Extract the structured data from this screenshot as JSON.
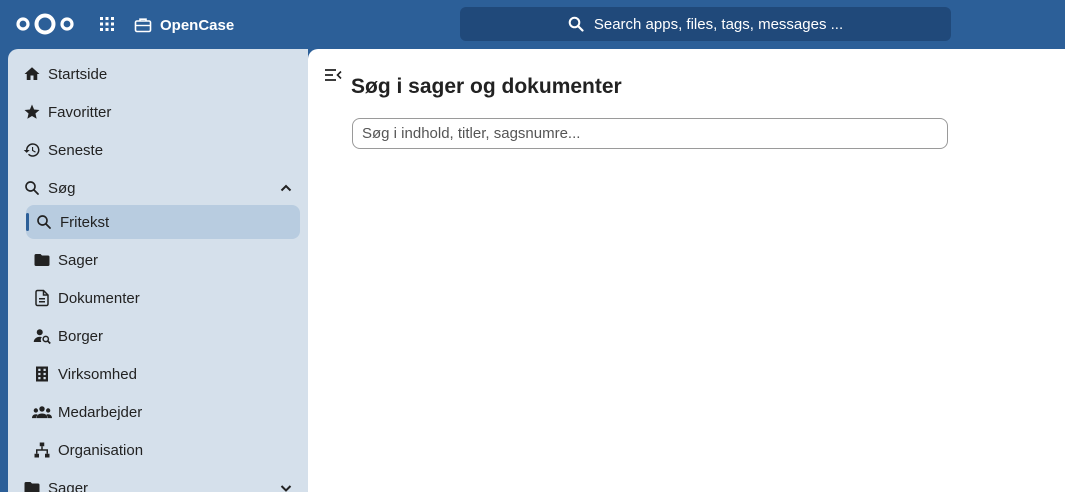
{
  "header": {
    "app_name": "OpenCase",
    "search_placeholder": "Search apps, files, tags, messages ..."
  },
  "sidebar": {
    "items": [
      {
        "label": "Startside",
        "icon": "home-icon"
      },
      {
        "label": "Favoritter",
        "icon": "star-icon"
      },
      {
        "label": "Seneste",
        "icon": "history-icon"
      },
      {
        "label": "Søg",
        "icon": "search-icon",
        "expanded": true
      },
      {
        "label": "Sager",
        "icon": "folder-icon",
        "expanded": false
      }
    ],
    "search_children": [
      {
        "label": "Fritekst",
        "icon": "search-icon",
        "active": true
      },
      {
        "label": "Sager",
        "icon": "folder-icon"
      },
      {
        "label": "Dokumenter",
        "icon": "document-icon"
      },
      {
        "label": "Borger",
        "icon": "person-search-icon"
      },
      {
        "label": "Virksomhed",
        "icon": "building-icon"
      },
      {
        "label": "Medarbejder",
        "icon": "group-icon"
      },
      {
        "label": "Organisation",
        "icon": "org-chart-icon"
      }
    ]
  },
  "main": {
    "title": "Søg i sager og dokumenter",
    "search_placeholder": "Søg i indhold, titler, sagsnumre..."
  },
  "colors": {
    "brand": "#2c5f98",
    "sidebar_bg": "#d5e0eb",
    "active_item_bg": "#b8cce0"
  }
}
